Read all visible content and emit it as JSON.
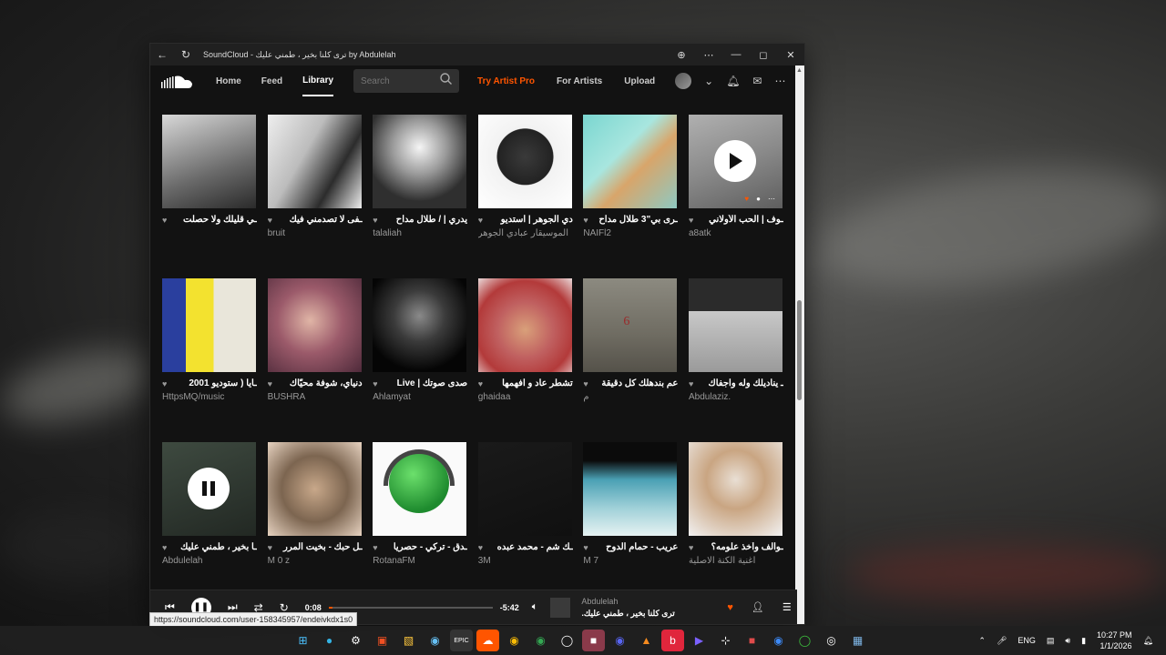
{
  "window": {
    "title": "SoundCloud - ترى كلنا بخير ، طمني عليك by Abdulelah",
    "controls": [
      "back-icon",
      "refresh-icon",
      "zoom-icon",
      "more-icon",
      "minimize-icon",
      "maximize-icon",
      "close-icon"
    ]
  },
  "nav": {
    "home": "Home",
    "feed": "Feed",
    "library": "Library",
    "search_placeholder": "Search",
    "try_pro": "Try Artist Pro",
    "for_artists": "For Artists",
    "upload": "Upload"
  },
  "cards": [
    {
      "title": "ـي قليلك ولا حصلت",
      "artist": "",
      "art": "bw-oud"
    },
    {
      "title": "ـفى لا تصدمني فيك",
      "artist": "bruit",
      "art": "bw-room"
    },
    {
      "title": "يدري | / طلال مداح",
      "artist": "talaliah",
      "art": "bw-man"
    },
    {
      "title": "دي الجوهر | استديو",
      "artist": "الموسيقار عبادي الجوهر",
      "art": "bw-portrait"
    },
    {
      "title": "ـرى بي\"3 طلال مداح",
      "artist": "NAIFl2",
      "art": "color-oud"
    },
    {
      "title": "ـوف | الحب الأولاني",
      "artist": "a8atk",
      "art": "gray-play"
    },
    {
      "title": "ـايا ( ستوديو 2001",
      "artist": "HttpsMQ/music",
      "art": "album-yellow"
    },
    {
      "title": "دنياي، شوفة محيّاك",
      "artist": "BUSHRA",
      "art": "woman-pink"
    },
    {
      "title": "صدى صوتك | Live",
      "artist": "Ahlamyat",
      "art": "woman-dark"
    },
    {
      "title": "تشطر عاد و افهمها",
      "artist": "ghaidaa",
      "art": "man-red"
    },
    {
      "title": "عم بندهلك كل دقيقة",
      "artist": "م",
      "art": "wall-6"
    },
    {
      "title": "ـ يناديلك وله واجفاك",
      "artist": "Abdulaziz.",
      "art": "gun-bed"
    },
    {
      "title": "ـا بخير ، طمني عليك",
      "artist": "Abdulelah",
      "art": "playing-dark"
    },
    {
      "title": "ـل حبك - بخيت المرر",
      "artist": "M 0 z",
      "art": "men-tea"
    },
    {
      "title": "ـدق - تركي - حصريا",
      "artist": "RotanaFM",
      "art": "rotana-logo"
    },
    {
      "title": "ـك شم - محمد عبده",
      "artist": "3M",
      "art": "dark"
    },
    {
      "title": "عريب - حمام الدوح",
      "artist": "M 7",
      "art": "woman-white"
    },
    {
      "title": "ـوالف وآخذ علومه؟",
      "artist": "أغنية الكنة الاصلية",
      "art": "man-phone"
    }
  ],
  "player": {
    "elapsed": "0:08",
    "remaining": "-5:42",
    "progress_fraction": 0.023,
    "artist": "Abdulelah",
    "song": "ترى كلنا بخير ، طمني عليك."
  },
  "url_tooltip": "https://soundcloud.com/user-158345957/endeivkdx1s0",
  "taskbar": {
    "lang": "ENG",
    "time": "10:27 PM",
    "date": "1/1/2026"
  },
  "colors": {
    "accent": "#ff5500",
    "background": "#121212"
  }
}
